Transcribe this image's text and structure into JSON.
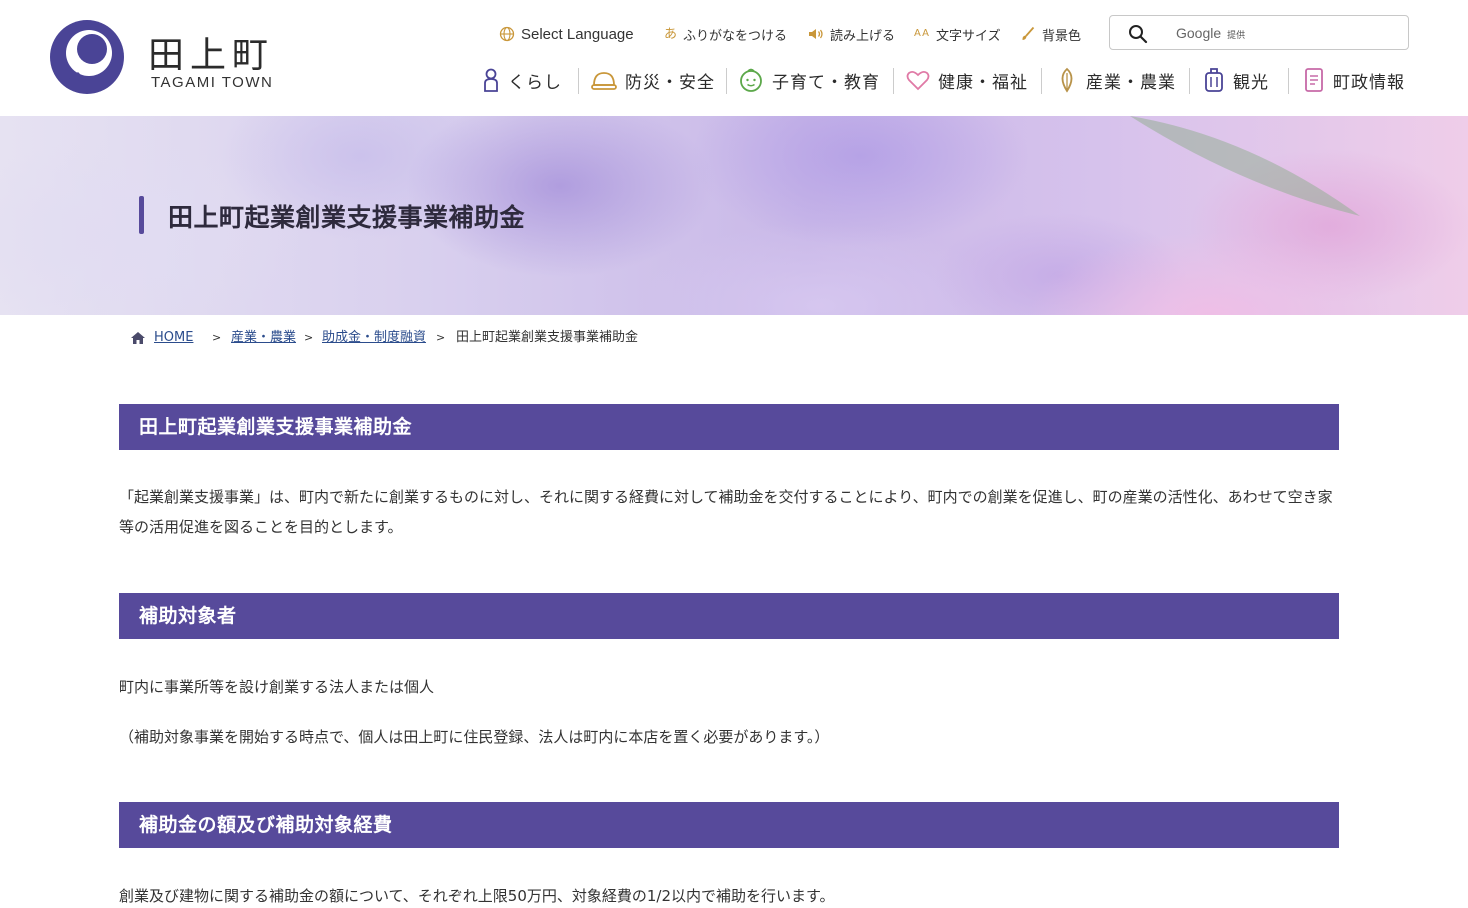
{
  "logo": {
    "kanji": "田上町",
    "roman": "TAGAMI TOWN"
  },
  "utility": {
    "language": "Select Language",
    "furigana": "ふりがなをつける",
    "read_aloud": "読み上げる",
    "text_size": "文字サイズ",
    "background_color": "背景色",
    "text_size_icon_text": "AA",
    "furigana_icon_text": "あ"
  },
  "search": {
    "brand": "Google",
    "brand_suffix": "提供"
  },
  "nav": {
    "items": [
      {
        "label": "くらし",
        "icon": "person-icon"
      },
      {
        "label": "防災・安全",
        "icon": "helmet-icon"
      },
      {
        "label": "子育て・教育",
        "icon": "child-face-icon"
      },
      {
        "label": "健康・福祉",
        "icon": "heart-icon"
      },
      {
        "label": "産業・農業",
        "icon": "rice-icon"
      },
      {
        "label": "観光",
        "icon": "suitcase-icon"
      },
      {
        "label": "町政情報",
        "icon": "document-icon"
      }
    ]
  },
  "hero": {
    "title": "田上町起業創業支援事業補助金"
  },
  "breadcrumb": {
    "items": [
      {
        "label": "HOME",
        "link": true
      },
      {
        "label": "産業・農業",
        "link": true
      },
      {
        "label": "助成金・制度融資",
        "link": true
      },
      {
        "label": "田上町起業創業支援事業補助金",
        "link": false
      }
    ],
    "separator": ">"
  },
  "content": {
    "sections": [
      {
        "heading": "田上町起業創業支援事業補助金",
        "paragraphs": [
          "「起業創業支援事業」は、町内で新たに創業するものに対し、それに関する経費に対して補助金を交付することにより、町内での創業を促進し、町の産業の活性化、あわせて空き家等の活用促進を図ることを目的とします。"
        ]
      },
      {
        "heading": "補助対象者",
        "paragraphs": [
          "町内に事業所等を設け創業する法人または個人",
          "（補助対象事業を開始する時点で、個人は田上町に住民登録、法人は町内に本店を置く必要があります。）"
        ]
      },
      {
        "heading": "補助金の額及び補助対象経費",
        "paragraphs": [
          "創業及び建物に関する補助金の額について、それぞれ上限50万円、対象経費の1/2以内で補助を行います。"
        ]
      }
    ]
  },
  "colors": {
    "accent": "#574a9b",
    "logo": "#4a4496",
    "link": "#2b4c8c",
    "util_icon": "#c9973a"
  }
}
